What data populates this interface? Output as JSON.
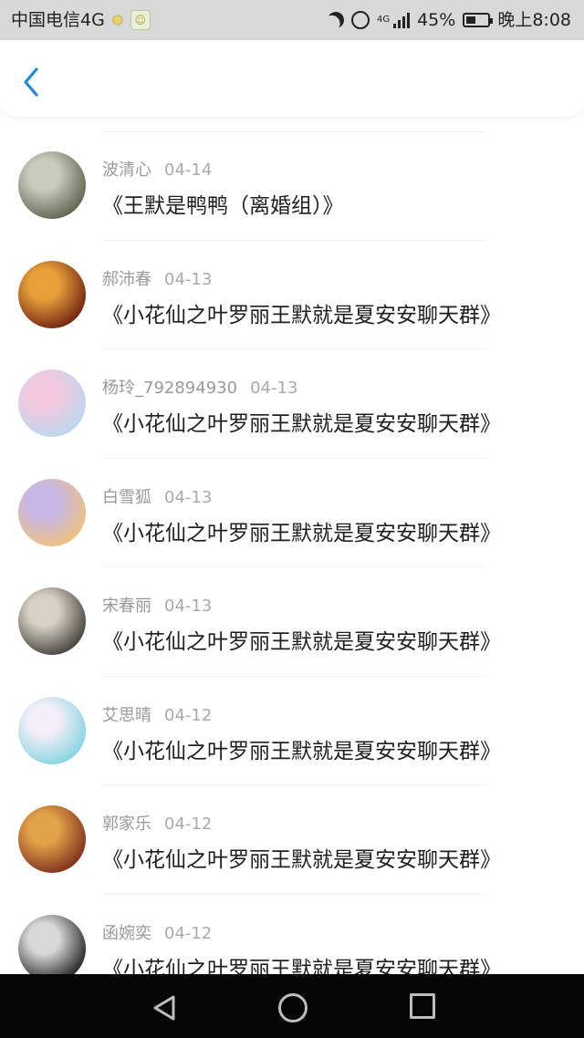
{
  "status_bar": {
    "carrier": "中国电信4G",
    "network_small": "4G",
    "battery_percent": "45%",
    "battery_level": 0.45,
    "time": "晚上8:08"
  },
  "header": {
    "back_icon": "chevron-left-icon",
    "accent_color": "#1e88e5"
  },
  "items": [
    {
      "name": "波清心",
      "date": "04-14",
      "title": "《王默是鸭鸭（离婚组）》",
      "avatar_colors": [
        "#5a5f4a",
        "#c9cbbf"
      ]
    },
    {
      "name": "郝沛春",
      "date": "04-13",
      "title": "《小花仙之叶罗丽王默就是夏安安聊天群》",
      "avatar_colors": [
        "#6b1d0f",
        "#e7a13b"
      ]
    },
    {
      "name": "杨玲_792894930",
      "date": "04-13",
      "title": "《小花仙之叶罗丽王默就是夏安安聊天群》",
      "avatar_colors": [
        "#b9d8f0",
        "#f2c9df"
      ]
    },
    {
      "name": "白雪狐",
      "date": "04-13",
      "title": "《小花仙之叶罗丽王默就是夏安安聊天群》",
      "avatar_colors": [
        "#f0c27a",
        "#c7b7e6"
      ]
    },
    {
      "name": "宋春丽",
      "date": "04-13",
      "title": "《小花仙之叶罗丽王默就是夏安安聊天群》",
      "avatar_colors": [
        "#3d3a35",
        "#d8d2c6"
      ]
    },
    {
      "name": "艾思晴",
      "date": "04-12",
      "title": "《小花仙之叶罗丽王默就是夏安安聊天群》",
      "avatar_colors": [
        "#7fd3e0",
        "#f3eef7"
      ]
    },
    {
      "name": "郭家乐",
      "date": "04-12",
      "title": "《小花仙之叶罗丽王默就是夏安安聊天群》",
      "avatar_colors": [
        "#7a2a1c",
        "#e2a247"
      ]
    },
    {
      "name": "函婉奕",
      "date": "04-12",
      "title": "《小花仙之叶罗丽王默就是夏安安聊天群》",
      "avatar_colors": [
        "#1a1a1a",
        "#d9d9d9"
      ]
    }
  ],
  "nav_bar": {
    "back_icon": "triangle-back-icon",
    "home_icon": "circle-home-icon",
    "recent_icon": "square-recents-icon"
  }
}
